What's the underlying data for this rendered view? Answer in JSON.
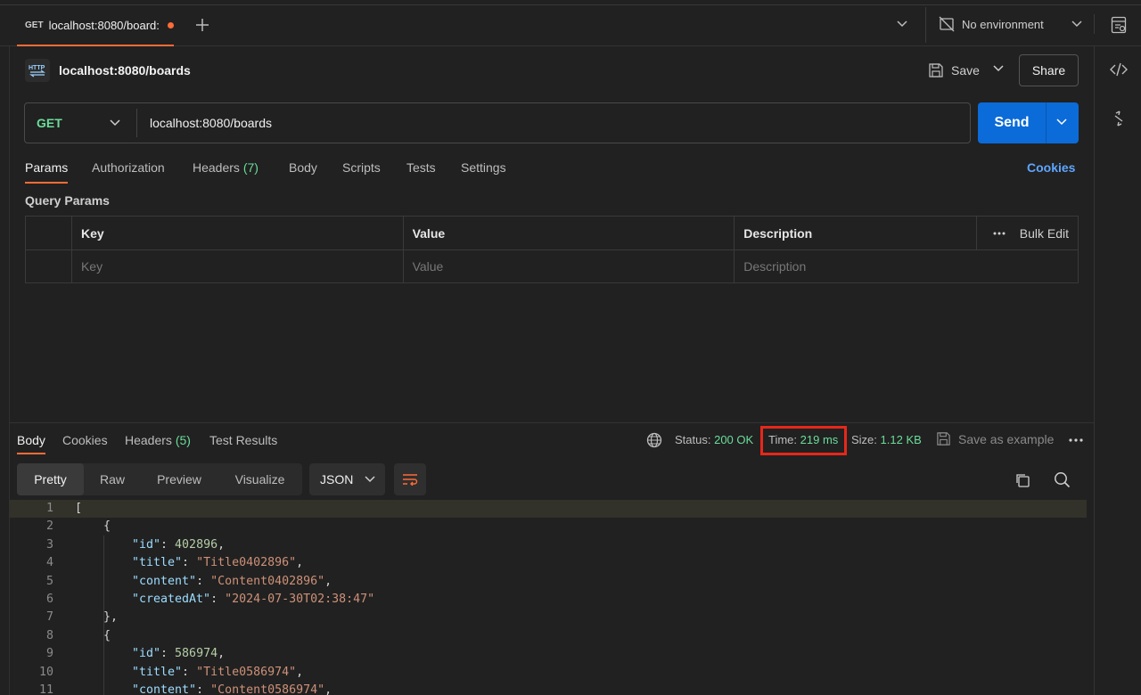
{
  "tab": {
    "method": "GET",
    "title": "localhost:8080/board:"
  },
  "environment": {
    "label": "No environment"
  },
  "request": {
    "name": "localhost:8080/boards",
    "save_label": "Save",
    "share_label": "Share",
    "method": "GET",
    "url": "localhost:8080/boards",
    "send_label": "Send"
  },
  "request_tabs": {
    "params": "Params",
    "authorization": "Authorization",
    "headers": "Headers",
    "headers_count": "(7)",
    "body": "Body",
    "scripts": "Scripts",
    "tests": "Tests",
    "settings": "Settings",
    "cookies": "Cookies"
  },
  "query_params": {
    "title": "Query Params",
    "columns": {
      "key": "Key",
      "value": "Value",
      "description": "Description"
    },
    "bulk_edit": "Bulk Edit",
    "placeholders": {
      "key": "Key",
      "value": "Value",
      "description": "Description"
    }
  },
  "response_tabs": {
    "body": "Body",
    "cookies": "Cookies",
    "headers": "Headers",
    "headers_count": "(5)",
    "test_results": "Test Results"
  },
  "response_meta": {
    "status_label": "Status:",
    "status_value": "200 OK",
    "time_label": "Time:",
    "time_value": "219 ms",
    "size_label": "Size:",
    "size_value": "1.12 KB",
    "save_example": "Save as example"
  },
  "view_modes": {
    "pretty": "Pretty",
    "raw": "Raw",
    "preview": "Preview",
    "visualize": "Visualize",
    "format": "JSON"
  },
  "code": {
    "line_numbers": [
      "1",
      "2",
      "3",
      "4",
      "5",
      "6",
      "7",
      "8",
      "9",
      "10",
      "11"
    ],
    "l1": "[",
    "l2": "{",
    "l3_key": "\"id\"",
    "l3_val": "402896",
    "l4_key": "\"title\"",
    "l4_val": "\"Title0402896\"",
    "l5_key": "\"content\"",
    "l5_val": "\"Content0402896\"",
    "l6_key": "\"createdAt\"",
    "l6_val": "\"2024-07-30T02:38:47\"",
    "l7": "},",
    "l8": "{",
    "l9_key": "\"id\"",
    "l9_val": "586974",
    "l10_key": "\"title\"",
    "l10_val": "\"Title0586974\"",
    "l11_key": "\"content\"",
    "l11_val": "\"Content0586974\""
  },
  "colors": {
    "accent": "#ff6c37",
    "send": "#0b6bd8",
    "success": "#6bdd9a",
    "highlight": "#e8271b",
    "link": "#5ea5ff"
  },
  "icons": [
    "plus-icon",
    "chevron-down-icon",
    "no-environment-icon",
    "environment-panel-icon",
    "code-icon",
    "related-icon",
    "http-icon",
    "save-icon",
    "globe-icon",
    "more-icon",
    "wrap-icon",
    "copy-icon",
    "search-icon"
  ]
}
